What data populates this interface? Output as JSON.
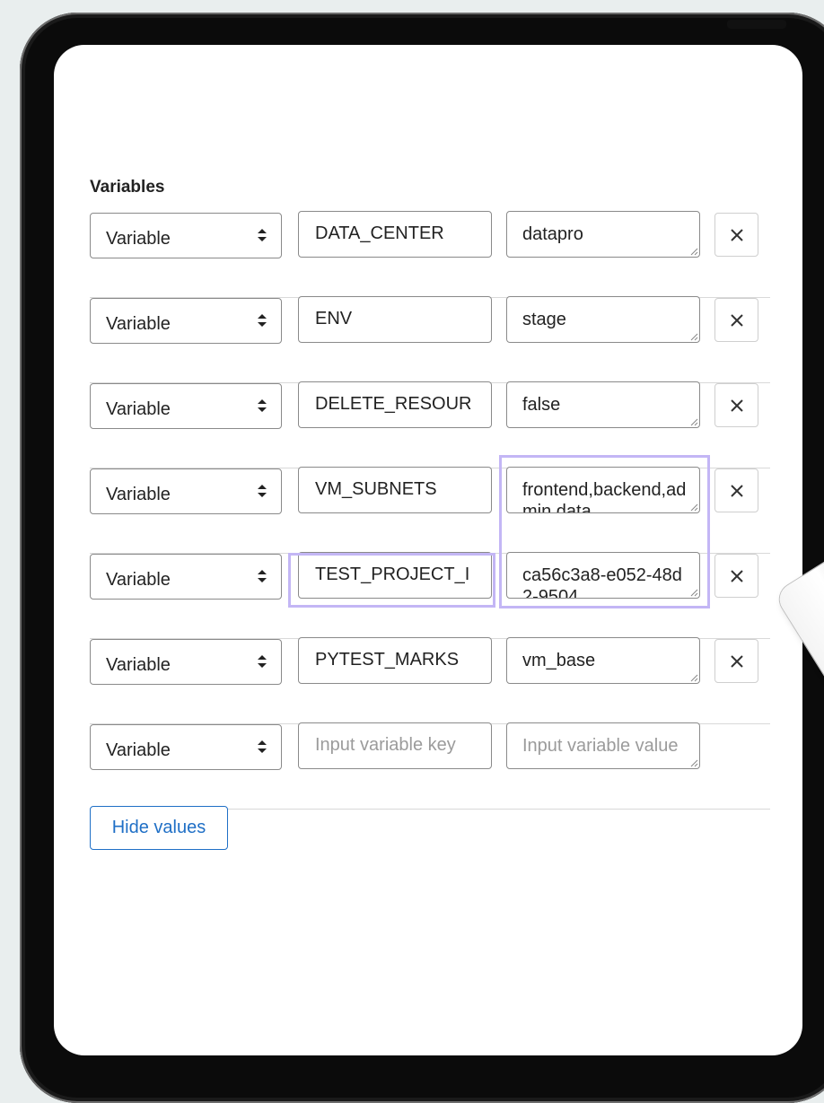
{
  "section_title": "Variables",
  "rows": [
    {
      "type": "Variable",
      "key": "DATA_CENTER",
      "value": "datapro"
    },
    {
      "type": "Variable",
      "key": "ENV",
      "value": "stage"
    },
    {
      "type": "Variable",
      "key": "DELETE_RESOUR",
      "value": "false"
    },
    {
      "type": "Variable",
      "key": "VM_SUBNETS",
      "value": "frontend,backend,admin,data"
    },
    {
      "type": "Variable",
      "key": "TEST_PROJECT_I",
      "value": "ca56c3a8-e052-48d2-9504"
    },
    {
      "type": "Variable",
      "key": "PYTEST_MARKS",
      "value": "vm_base"
    }
  ],
  "new_row": {
    "type": "Variable",
    "key_placeholder": "Input variable key",
    "value_placeholder": "Input variable value"
  },
  "hide_values_label": "Hide values",
  "colors": {
    "accent": "#1f6fc6",
    "highlight": "#c3b6f5",
    "border": "#8a8a8a"
  },
  "icons": {
    "select": "sort-arrows-icon",
    "remove": "close-icon",
    "resize": "resize-grip-icon"
  }
}
